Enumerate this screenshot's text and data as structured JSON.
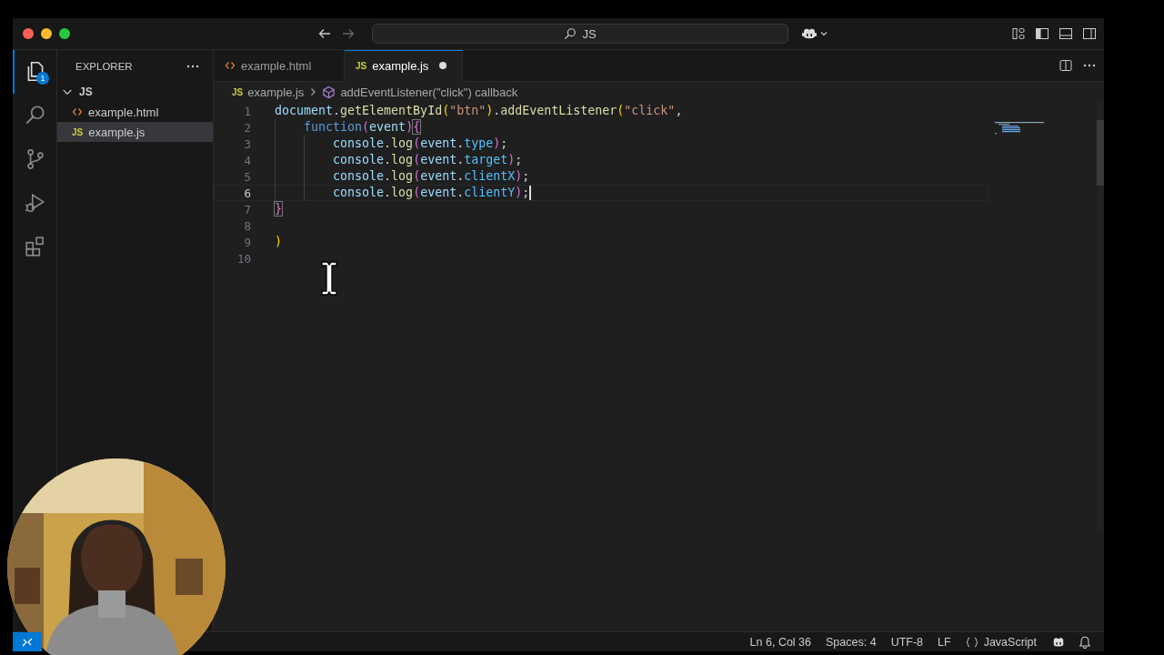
{
  "title_bar": {
    "search": {
      "value": "JS"
    }
  },
  "activity_bar": {
    "items": [
      {
        "kind": "files",
        "selected": true,
        "badge": "1"
      },
      {
        "kind": "search",
        "selected": false
      },
      {
        "kind": "source-control",
        "selected": false
      },
      {
        "kind": "run",
        "selected": false
      },
      {
        "kind": "extensions",
        "selected": false
      }
    ]
  },
  "sidebar": {
    "title": "EXPLORER",
    "folder": {
      "name": "JS",
      "expanded": true,
      "children": [
        {
          "name": "example.html",
          "kind": "html",
          "selected": false
        },
        {
          "name": "example.js",
          "kind": "js",
          "badge": "JS",
          "selected": true
        }
      ]
    }
  },
  "tabs": [
    {
      "label": "example.html",
      "kind": "html",
      "selected": false,
      "modified": false
    },
    {
      "label": "example.js",
      "kind": "js",
      "badge": "JS",
      "selected": true,
      "modified": true
    }
  ],
  "breadcrumb": {
    "file": {
      "label": "example.js",
      "badge": "JS"
    },
    "symbol": "addEventListener(\"click\") callback"
  },
  "editor": {
    "lines": [
      {
        "number": "1",
        "current": false,
        "tokens": [
          {
            "kind": "var",
            "text": "document"
          },
          {
            "kind": "plain",
            "text": "."
          },
          {
            "kind": "func",
            "text": "getElementById"
          },
          {
            "kind": "b1",
            "text": "("
          },
          {
            "kind": "str",
            "text": "\"btn\""
          },
          {
            "kind": "b1",
            "text": ")"
          },
          {
            "kind": "plain",
            "text": "."
          },
          {
            "kind": "func",
            "text": "addEventListener"
          },
          {
            "kind": "b1",
            "text": "("
          },
          {
            "kind": "str",
            "text": "\"click\""
          },
          {
            "kind": "plain",
            "text": ","
          }
        ]
      },
      {
        "number": "2",
        "current": false,
        "tokens": [
          {
            "kind": "kw",
            "text": "    function"
          },
          {
            "kind": "b2",
            "text": "("
          },
          {
            "kind": "var",
            "text": "event"
          },
          {
            "kind": "b2",
            "text": ")"
          },
          {
            "kind": "match",
            "text": "{"
          }
        ]
      },
      {
        "number": "3",
        "current": false,
        "tokens": [
          {
            "kind": "var",
            "text": "        console"
          },
          {
            "kind": "plain",
            "text": "."
          },
          {
            "kind": "func",
            "text": "log"
          },
          {
            "kind": "b3",
            "text": "("
          },
          {
            "kind": "var",
            "text": "event"
          },
          {
            "kind": "plain",
            "text": "."
          },
          {
            "kind": "prop",
            "text": "type"
          },
          {
            "kind": "b3",
            "text": ")"
          },
          {
            "kind": "plain",
            "text": ";"
          }
        ]
      },
      {
        "number": "4",
        "current": false,
        "tokens": [
          {
            "kind": "var",
            "text": "        console"
          },
          {
            "kind": "plain",
            "text": "."
          },
          {
            "kind": "func",
            "text": "log"
          },
          {
            "kind": "b3",
            "text": "("
          },
          {
            "kind": "var",
            "text": "event"
          },
          {
            "kind": "plain",
            "text": "."
          },
          {
            "kind": "prop",
            "text": "target"
          },
          {
            "kind": "b3",
            "text": ")"
          },
          {
            "kind": "plain",
            "text": ";"
          }
        ]
      },
      {
        "number": "5",
        "current": false,
        "tokens": [
          {
            "kind": "var",
            "text": "        console"
          },
          {
            "kind": "plain",
            "text": "."
          },
          {
            "kind": "func",
            "text": "log"
          },
          {
            "kind": "b3",
            "text": "("
          },
          {
            "kind": "var",
            "text": "event"
          },
          {
            "kind": "plain",
            "text": "."
          },
          {
            "kind": "prop",
            "text": "clientX"
          },
          {
            "kind": "b3",
            "text": ")"
          },
          {
            "kind": "plain",
            "text": ";"
          }
        ]
      },
      {
        "number": "6",
        "current": true,
        "tokens": [
          {
            "kind": "var",
            "text": "        console"
          },
          {
            "kind": "plain",
            "text": "."
          },
          {
            "kind": "func",
            "text": "log"
          },
          {
            "kind": "b3",
            "text": "("
          },
          {
            "kind": "var",
            "text": "event"
          },
          {
            "kind": "plain",
            "text": "."
          },
          {
            "kind": "prop",
            "text": "clientY"
          },
          {
            "kind": "b3",
            "text": ")"
          },
          {
            "kind": "plain",
            "text": ";"
          }
        ]
      },
      {
        "number": "7",
        "current": false,
        "tokens": [
          {
            "kind": "match",
            "text": "}"
          }
        ]
      },
      {
        "number": "8",
        "current": false
      },
      {
        "number": "9",
        "current": false,
        "tokens": [
          {
            "kind": "b1",
            "text": ")"
          }
        ]
      },
      {
        "number": "10",
        "current": false
      }
    ]
  },
  "status_bar": {
    "items": [
      "Ln 6, Col 36",
      "Spaces: 4",
      "UTF-8",
      "LF"
    ],
    "language": "JavaScript"
  }
}
